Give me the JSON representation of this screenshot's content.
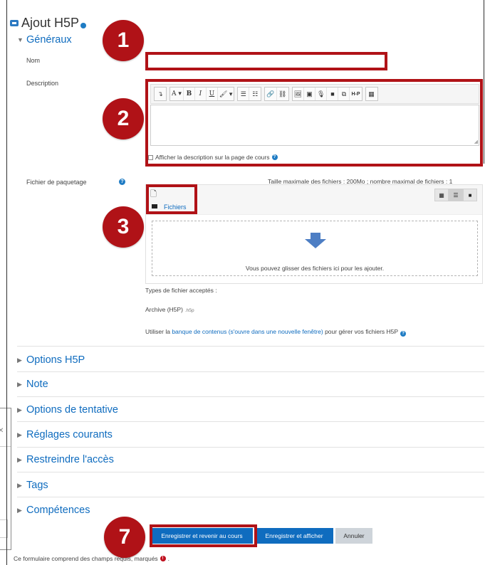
{
  "page": {
    "title": "Ajout H5P",
    "sections": {
      "generaux": "Généraux",
      "options_h5p": "Options H5P",
      "note": "Note",
      "options_tentative": "Options de tentative",
      "reglages_courants": "Réglages courants",
      "restreindre": "Restreindre l'accès",
      "tags": "Tags",
      "competences": "Compétences"
    }
  },
  "form": {
    "nom_label": "Nom",
    "nom_value": "",
    "description_label": "Description",
    "description_value": "",
    "show_description_label": "Afficher la description sur la page de cours",
    "show_description_checked": false,
    "toolbar": [
      "↴",
      "A ▾",
      "B",
      "I",
      "U",
      "🖌 ▾",
      "☰",
      "☷",
      "🔗",
      "⛓",
      "🖼",
      "▣",
      "🎙",
      "■",
      "⧉",
      "H-P",
      "▦"
    ],
    "fichier_label": "Fichier de paquetage",
    "max_size_text": "Taille maximale des fichiers : 200Mo ; nombre maximal de fichiers : 1",
    "filepicker": {
      "folder_label": "Fichiers",
      "drop_text": "Vous pouvez glisser des fichiers ici pour les ajouter.",
      "view_icons": [
        "grid-view-icon",
        "list-view-icon",
        "tree-view-icon"
      ]
    },
    "accepted_types_label": "Types de fichier acceptés :",
    "accepted_type": "Archive (H5P)",
    "accepted_ext": ".h5p",
    "content_bank_text_before": "Utiliser la ",
    "content_bank_link": "banque de contenus (s'ouvre dans une nouvelle fenêtre)",
    "content_bank_text_after": " pour gérer vos fichiers H5P"
  },
  "buttons": {
    "save_return": "Enregistrer et revenir au cours",
    "save_display": "Enregistrer et afficher",
    "cancel": "Annuler"
  },
  "footer": {
    "required_text": "Ce formulaire comprend des champs requis, marqués",
    "suffix": "."
  },
  "callouts": [
    "1",
    "2",
    "3",
    "7"
  ],
  "colors": {
    "accent": "#0f6cbf",
    "highlight": "#b01217",
    "secondary_button": "#ced4da"
  }
}
